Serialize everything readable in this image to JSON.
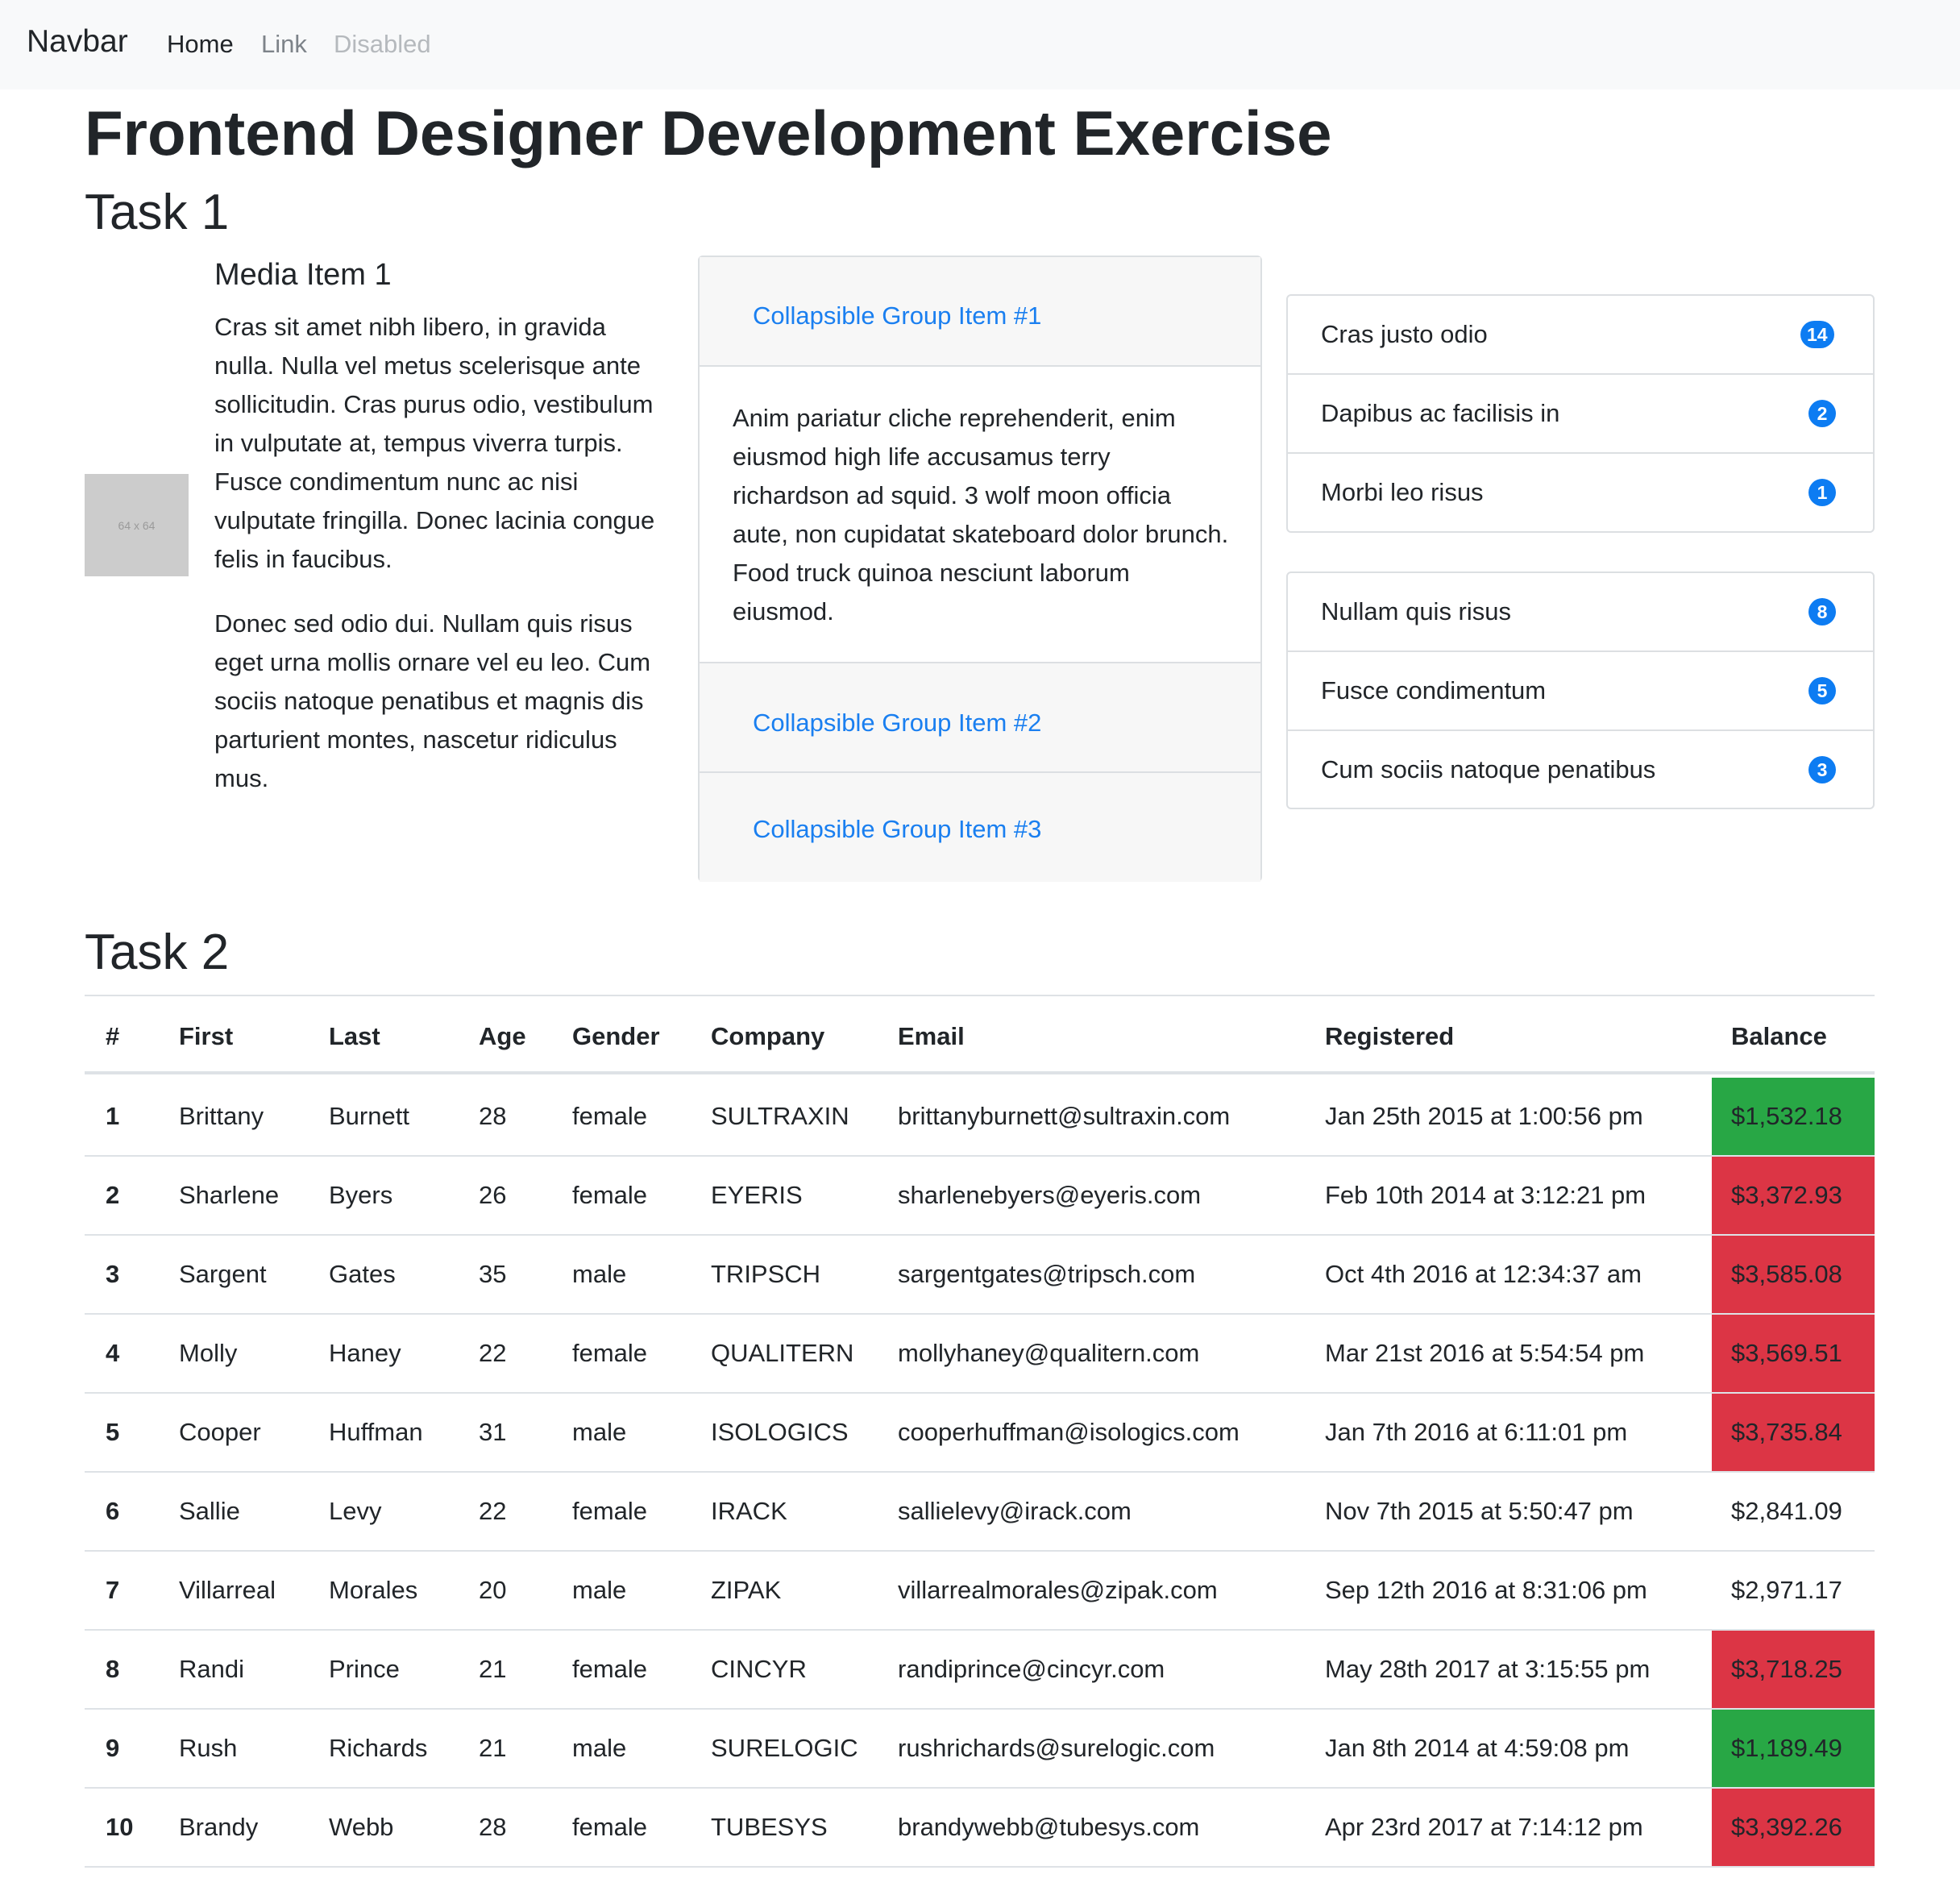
{
  "navbar": {
    "brand": "Navbar",
    "links": [
      "Home",
      "Link",
      "Disabled"
    ]
  },
  "page_title": "Frontend Designer Development Exercise",
  "task1": {
    "heading": "Task 1",
    "media": {
      "image_label": "64 x 64",
      "title": "Media Item 1",
      "paragraphs": [
        "Cras sit amet nibh libero, in gravida nulla. Nulla vel metus scelerisque ante sollicitudin. Cras purus odio, vestibulum in vulputate at, tempus viverra turpis. Fusce condimentum nunc ac nisi vulputate fringilla. Donec lacinia congue felis in faucibus.",
        "Donec sed odio dui. Nullam quis risus eget urna mollis ornare vel eu leo. Cum sociis natoque penatibus et magnis dis parturient montes, nascetur ridiculus mus."
      ]
    },
    "accordion": {
      "items": [
        "Collapsible Group Item #1",
        "Collapsible Group Item #2",
        "Collapsible Group Item #3"
      ],
      "body": "Anim pariatur cliche reprehenderit, enim eiusmod high life accusamus terry richardson ad squid. 3 wolf moon officia aute, non cupidatat skateboard dolor brunch. Food truck quinoa nesciunt laborum eiusmod."
    },
    "list_groups": [
      [
        {
          "label": "Cras justo odio",
          "badge": "14"
        },
        {
          "label": "Dapibus ac facilisis in",
          "badge": "2"
        },
        {
          "label": "Morbi leo risus",
          "badge": "1"
        }
      ],
      [
        {
          "label": "Nullam quis risus",
          "badge": "8"
        },
        {
          "label": "Fusce condimentum",
          "badge": "5"
        },
        {
          "label": "Cum sociis natoque penatibus",
          "badge": "3"
        }
      ]
    ]
  },
  "task2": {
    "heading": "Task 2",
    "columns": [
      "#",
      "First",
      "Last",
      "Age",
      "Gender",
      "Company",
      "Email",
      "Registered",
      "Balance"
    ],
    "rows": [
      {
        "num": "1",
        "first": "Brittany",
        "last": "Burnett",
        "age": "28",
        "gender": "female",
        "company": "SULTRAXIN",
        "email": "brittanyburnett@sultraxin.com",
        "registered": "Jan 25th 2015 at 1:00:56 pm",
        "balance": "$1,532.18",
        "status": "low"
      },
      {
        "num": "2",
        "first": "Sharlene",
        "last": "Byers",
        "age": "26",
        "gender": "female",
        "company": "EYERIS",
        "email": "sharlenebyers@eyeris.com",
        "registered": "Feb 10th 2014 at 3:12:21 pm",
        "balance": "$3,372.93",
        "status": "high"
      },
      {
        "num": "3",
        "first": "Sargent",
        "last": "Gates",
        "age": "35",
        "gender": "male",
        "company": "TRIPSCH",
        "email": "sargentgates@tripsch.com",
        "registered": "Oct 4th 2016 at 12:34:37 am",
        "balance": "$3,585.08",
        "status": "high"
      },
      {
        "num": "4",
        "first": "Molly",
        "last": "Haney",
        "age": "22",
        "gender": "female",
        "company": "QUALITERN",
        "email": "mollyhaney@qualitern.com",
        "registered": "Mar 21st 2016 at 5:54:54 pm",
        "balance": "$3,569.51",
        "status": "high"
      },
      {
        "num": "5",
        "first": "Cooper",
        "last": "Huffman",
        "age": "31",
        "gender": "male",
        "company": "ISOLOGICS",
        "email": "cooperhuffman@isologics.com",
        "registered": "Jan 7th 2016 at 6:11:01 pm",
        "balance": "$3,735.84",
        "status": "high"
      },
      {
        "num": "6",
        "first": "Sallie",
        "last": "Levy",
        "age": "22",
        "gender": "female",
        "company": "IRACK",
        "email": "sallielevy@irack.com",
        "registered": "Nov 7th 2015 at 5:50:47 pm",
        "balance": "$2,841.09",
        "status": "normal"
      },
      {
        "num": "7",
        "first": "Villarreal",
        "last": "Morales",
        "age": "20",
        "gender": "male",
        "company": "ZIPAK",
        "email": "villarrealmorales@zipak.com",
        "registered": "Sep 12th 2016 at 8:31:06 pm",
        "balance": "$2,971.17",
        "status": "normal"
      },
      {
        "num": "8",
        "first": "Randi",
        "last": "Prince",
        "age": "21",
        "gender": "female",
        "company": "CINCYR",
        "email": "randiprince@cincyr.com",
        "registered": "May 28th 2017 at 3:15:55 pm",
        "balance": "$3,718.25",
        "status": "high"
      },
      {
        "num": "9",
        "first": "Rush",
        "last": "Richards",
        "age": "21",
        "gender": "male",
        "company": "SURELOGIC",
        "email": "rushrichards@surelogic.com",
        "registered": "Jan 8th 2014 at 4:59:08 pm",
        "balance": "$1,189.49",
        "status": "low"
      },
      {
        "num": "10",
        "first": "Brandy",
        "last": "Webb",
        "age": "28",
        "gender": "female",
        "company": "TUBESYS",
        "email": "brandywebb@tubesys.com",
        "registered": "Apr 23rd 2017 at 7:14:12 pm",
        "balance": "$3,392.26",
        "status": "high"
      }
    ],
    "status_colors": {
      "low": "#28a745",
      "high": "#dc3545",
      "normal": "#ffffff"
    }
  },
  "colors": {
    "link": "#1a7ff0",
    "badge": "#0d7cf2",
    "navbar_bg": "#f8f9fa",
    "card_header_bg": "#f7f7f7"
  }
}
